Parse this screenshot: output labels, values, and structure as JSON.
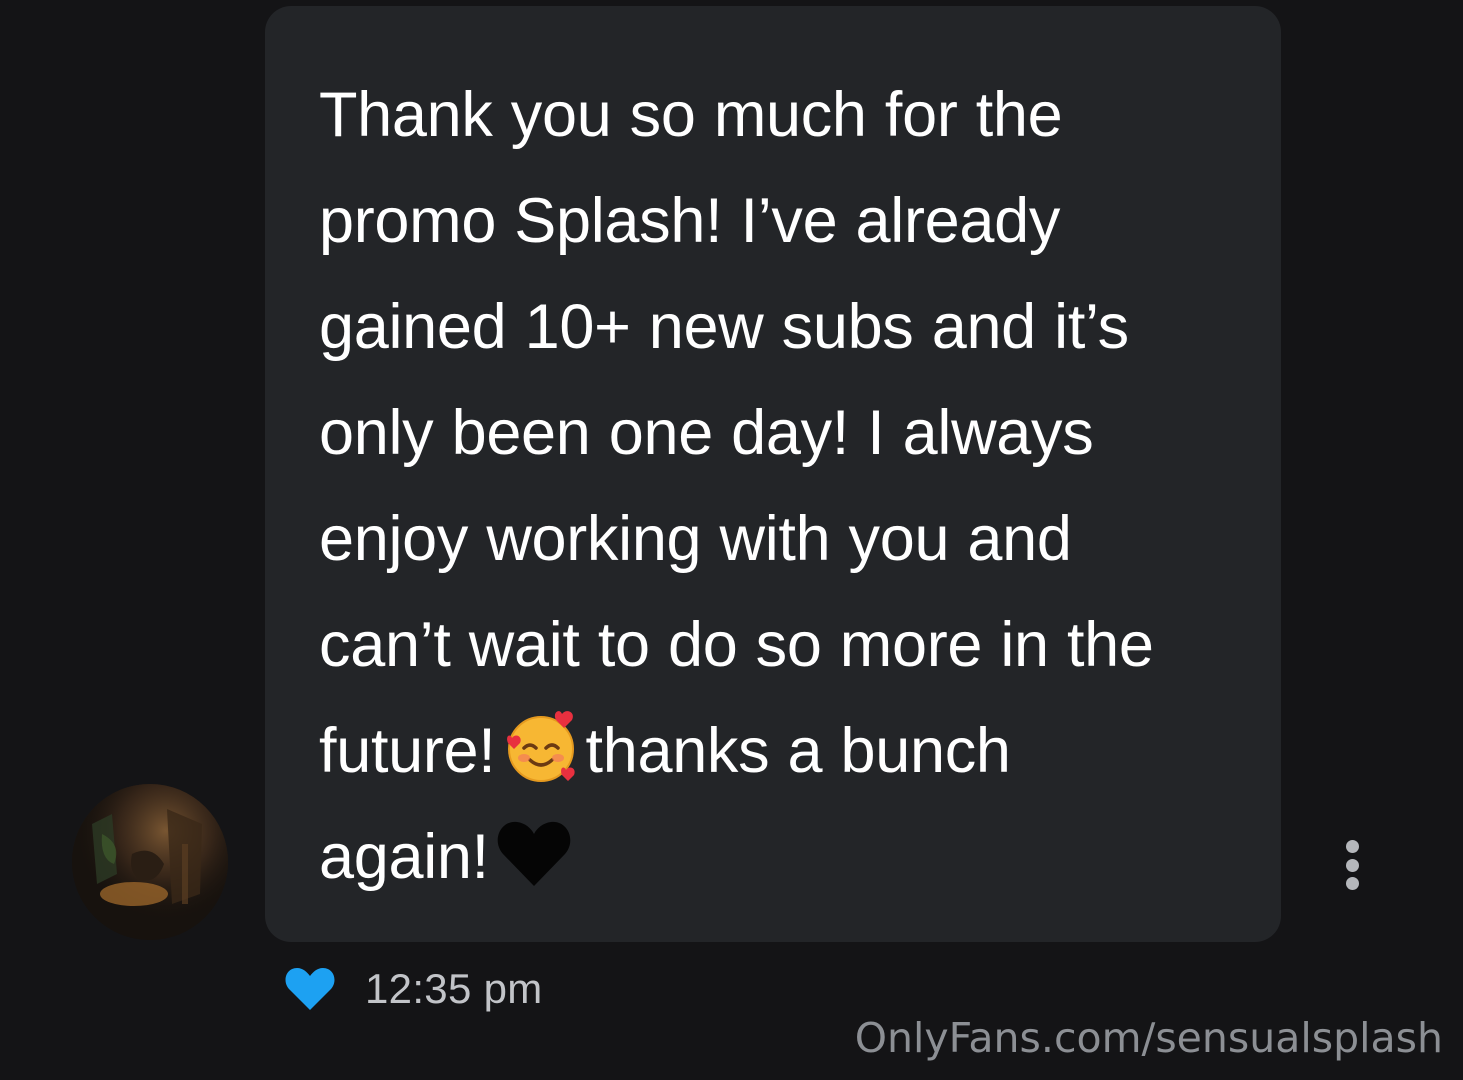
{
  "message": {
    "lines": [
      "Thank you so much for the",
      "promo Splash! I’ve already",
      "gained 10+ new subs and it’s",
      "only been one day! I always",
      "enjoy working with you and",
      "can’t wait to do so more in the"
    ],
    "line7_before": "future!",
    "line7_after": "thanks a bunch",
    "line8": "again!",
    "emoji_1": "smiling-face-with-hearts-icon",
    "emoji_2": "black-heart-icon"
  },
  "meta": {
    "time": "12:35 pm",
    "like_icon": "heart-icon",
    "like_color": "#1da1f2"
  },
  "watermark": "OnlyFans.com/sensualsplash",
  "colors": {
    "background": "#141416",
    "bubble": "#232528",
    "text": "#ffffff",
    "time": "#c2c4c8",
    "watermark": "#8c8f94"
  }
}
